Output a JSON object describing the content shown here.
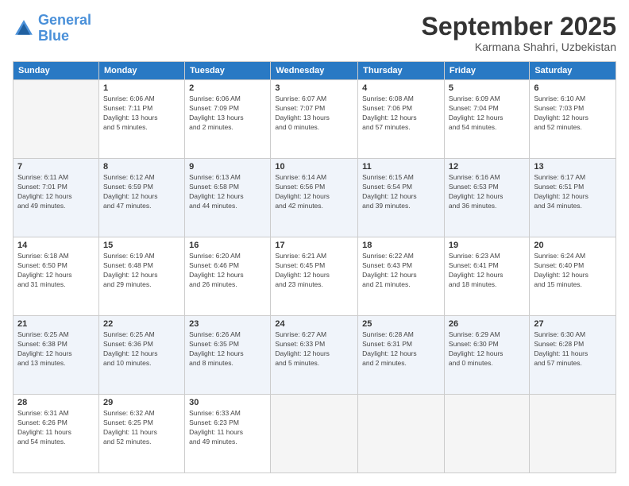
{
  "header": {
    "logo_line1": "General",
    "logo_line2": "Blue",
    "month": "September 2025",
    "location": "Karmana Shahri, Uzbekistan"
  },
  "weekdays": [
    "Sunday",
    "Monday",
    "Tuesday",
    "Wednesday",
    "Thursday",
    "Friday",
    "Saturday"
  ],
  "weeks": [
    [
      {
        "day": "",
        "info": ""
      },
      {
        "day": "1",
        "info": "Sunrise: 6:06 AM\nSunset: 7:11 PM\nDaylight: 13 hours\nand 5 minutes."
      },
      {
        "day": "2",
        "info": "Sunrise: 6:06 AM\nSunset: 7:09 PM\nDaylight: 13 hours\nand 2 minutes."
      },
      {
        "day": "3",
        "info": "Sunrise: 6:07 AM\nSunset: 7:07 PM\nDaylight: 13 hours\nand 0 minutes."
      },
      {
        "day": "4",
        "info": "Sunrise: 6:08 AM\nSunset: 7:06 PM\nDaylight: 12 hours\nand 57 minutes."
      },
      {
        "day": "5",
        "info": "Sunrise: 6:09 AM\nSunset: 7:04 PM\nDaylight: 12 hours\nand 54 minutes."
      },
      {
        "day": "6",
        "info": "Sunrise: 6:10 AM\nSunset: 7:03 PM\nDaylight: 12 hours\nand 52 minutes."
      }
    ],
    [
      {
        "day": "7",
        "info": "Sunrise: 6:11 AM\nSunset: 7:01 PM\nDaylight: 12 hours\nand 49 minutes."
      },
      {
        "day": "8",
        "info": "Sunrise: 6:12 AM\nSunset: 6:59 PM\nDaylight: 12 hours\nand 47 minutes."
      },
      {
        "day": "9",
        "info": "Sunrise: 6:13 AM\nSunset: 6:58 PM\nDaylight: 12 hours\nand 44 minutes."
      },
      {
        "day": "10",
        "info": "Sunrise: 6:14 AM\nSunset: 6:56 PM\nDaylight: 12 hours\nand 42 minutes."
      },
      {
        "day": "11",
        "info": "Sunrise: 6:15 AM\nSunset: 6:54 PM\nDaylight: 12 hours\nand 39 minutes."
      },
      {
        "day": "12",
        "info": "Sunrise: 6:16 AM\nSunset: 6:53 PM\nDaylight: 12 hours\nand 36 minutes."
      },
      {
        "day": "13",
        "info": "Sunrise: 6:17 AM\nSunset: 6:51 PM\nDaylight: 12 hours\nand 34 minutes."
      }
    ],
    [
      {
        "day": "14",
        "info": "Sunrise: 6:18 AM\nSunset: 6:50 PM\nDaylight: 12 hours\nand 31 minutes."
      },
      {
        "day": "15",
        "info": "Sunrise: 6:19 AM\nSunset: 6:48 PM\nDaylight: 12 hours\nand 29 minutes."
      },
      {
        "day": "16",
        "info": "Sunrise: 6:20 AM\nSunset: 6:46 PM\nDaylight: 12 hours\nand 26 minutes."
      },
      {
        "day": "17",
        "info": "Sunrise: 6:21 AM\nSunset: 6:45 PM\nDaylight: 12 hours\nand 23 minutes."
      },
      {
        "day": "18",
        "info": "Sunrise: 6:22 AM\nSunset: 6:43 PM\nDaylight: 12 hours\nand 21 minutes."
      },
      {
        "day": "19",
        "info": "Sunrise: 6:23 AM\nSunset: 6:41 PM\nDaylight: 12 hours\nand 18 minutes."
      },
      {
        "day": "20",
        "info": "Sunrise: 6:24 AM\nSunset: 6:40 PM\nDaylight: 12 hours\nand 15 minutes."
      }
    ],
    [
      {
        "day": "21",
        "info": "Sunrise: 6:25 AM\nSunset: 6:38 PM\nDaylight: 12 hours\nand 13 minutes."
      },
      {
        "day": "22",
        "info": "Sunrise: 6:25 AM\nSunset: 6:36 PM\nDaylight: 12 hours\nand 10 minutes."
      },
      {
        "day": "23",
        "info": "Sunrise: 6:26 AM\nSunset: 6:35 PM\nDaylight: 12 hours\nand 8 minutes."
      },
      {
        "day": "24",
        "info": "Sunrise: 6:27 AM\nSunset: 6:33 PM\nDaylight: 12 hours\nand 5 minutes."
      },
      {
        "day": "25",
        "info": "Sunrise: 6:28 AM\nSunset: 6:31 PM\nDaylight: 12 hours\nand 2 minutes."
      },
      {
        "day": "26",
        "info": "Sunrise: 6:29 AM\nSunset: 6:30 PM\nDaylight: 12 hours\nand 0 minutes."
      },
      {
        "day": "27",
        "info": "Sunrise: 6:30 AM\nSunset: 6:28 PM\nDaylight: 11 hours\nand 57 minutes."
      }
    ],
    [
      {
        "day": "28",
        "info": "Sunrise: 6:31 AM\nSunset: 6:26 PM\nDaylight: 11 hours\nand 54 minutes."
      },
      {
        "day": "29",
        "info": "Sunrise: 6:32 AM\nSunset: 6:25 PM\nDaylight: 11 hours\nand 52 minutes."
      },
      {
        "day": "30",
        "info": "Sunrise: 6:33 AM\nSunset: 6:23 PM\nDaylight: 11 hours\nand 49 minutes."
      },
      {
        "day": "",
        "info": ""
      },
      {
        "day": "",
        "info": ""
      },
      {
        "day": "",
        "info": ""
      },
      {
        "day": "",
        "info": ""
      }
    ]
  ]
}
